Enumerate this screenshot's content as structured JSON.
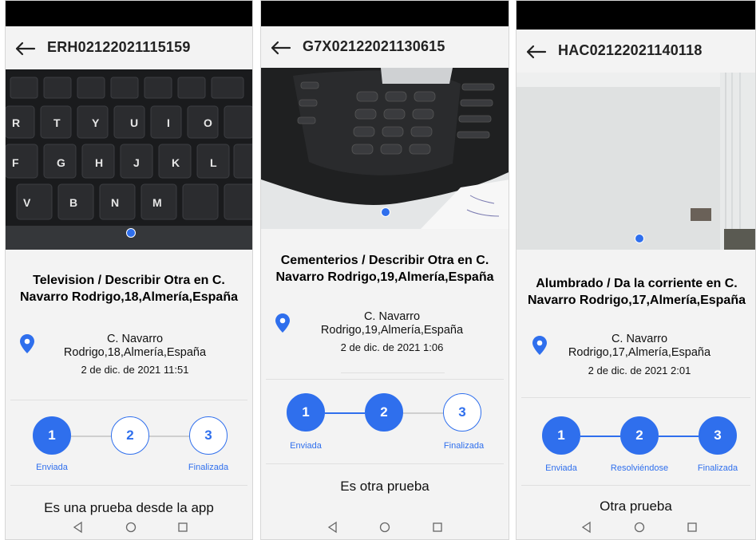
{
  "phones": [
    {
      "code": "ERH02122021115159",
      "incident_title": "Television / Describir Otra en C. Navarro Rodrigo,18,Almería,España",
      "address": "C. Navarro Rodrigo,18,Almería,España",
      "date": "2 de dic. de 2021 11:51",
      "steps": [
        {
          "number": "1",
          "label": "Enviada",
          "status": "done"
        },
        {
          "number": "2",
          "label": "",
          "status": "todo"
        },
        {
          "number": "3",
          "label": "Finalizada",
          "status": "todo"
        }
      ],
      "comment": "Es una prueba desde la app",
      "photo": "laptop-keyboard"
    },
    {
      "code": "G7X02122021130615",
      "incident_title": "Cementerios / Describir Otra en C. Navarro Rodrigo,19,Almería,España",
      "address": "C. Navarro Rodrigo,19,Almería,España",
      "date": "2 de dic. de 2021 1:06",
      "steps": [
        {
          "number": "1",
          "label": "Enviada",
          "status": "done"
        },
        {
          "number": "2",
          "label": "",
          "status": "done"
        },
        {
          "number": "3",
          "label": "Finalizada",
          "status": "todo"
        }
      ],
      "comment": "Es otra prueba",
      "photo": "desk-phone"
    },
    {
      "code": "HAC02122021140118",
      "incident_title": "Alumbrado / Da la corriente en C. Navarro Rodrigo,17,Almería,España",
      "address": "C. Navarro Rodrigo,17,Almería,España",
      "date": "2 de dic. de 2021 2:01",
      "steps": [
        {
          "number": "1",
          "label": "Enviada",
          "status": "done"
        },
        {
          "number": "2",
          "label": "Resolviéndose",
          "status": "done"
        },
        {
          "number": "3",
          "label": "Finalizada",
          "status": "done"
        }
      ],
      "comment": "Otra prueba",
      "photo": "room-ceiling"
    }
  ],
  "icons": {
    "back": "arrow-left-icon",
    "location": "map-pin-icon",
    "nav_back": "triangle-back-icon",
    "nav_home": "circle-home-icon",
    "nav_recents": "square-recents-icon"
  },
  "colors": {
    "accent": "#2f6fed",
    "status_bar": "#000000",
    "background": "#f3f3f3"
  }
}
